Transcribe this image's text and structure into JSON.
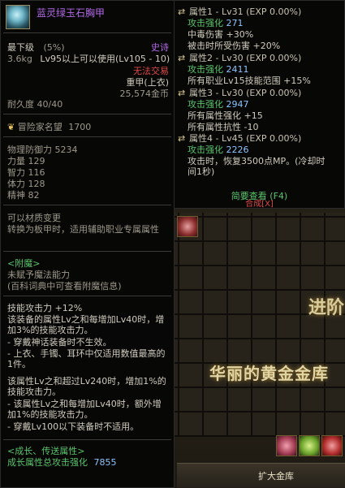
{
  "item": {
    "name": "蓝灵绿玉石胸甲",
    "grade": "最下级",
    "grade_pct": "(5%)",
    "rarity": "史诗",
    "weight": "3.6kg",
    "level_req": "Lv95以上可以使用(Lv105 - 10)",
    "trade": "无法交易",
    "slot": "重甲(上衣)",
    "price": "25,574金币",
    "durability": "耐久度 40/40",
    "fame_label": "冒险家名望",
    "fame_value": "1700",
    "stats": [
      {
        "label": "物理防御力",
        "value": "5234"
      },
      {
        "label": "力量",
        "value": "129"
      },
      {
        "label": "智力",
        "value": "116"
      },
      {
        "label": "体力",
        "value": "128"
      },
      {
        "label": "精神",
        "value": "82"
      }
    ],
    "material_change": "可以材质变更",
    "material_note": "转换为板甲时，适用辅助职业专属属性",
    "enchant_header": "<附魔>",
    "enchant_none": "未赋予魔法能力",
    "enchant_hint": "(百科词典中可查看附魔信息)",
    "skill_attack": "技能攻击力 +12%",
    "desc1": "该装备的属性Lv之和每增加Lv40时，增加3%的技能攻击力。",
    "desc2": "- 穿戴神话装备时不生效。",
    "desc3": "- 上衣、手镯、耳环中仅适用数值最高的1件。",
    "desc4": "该属性Lv之和超过Lv240时，增加1%的技能攻击力。",
    "desc5": "- 该属性Lv之和每增加Lv40时，额外增加1%的技能攻击力。",
    "desc6": "- 穿戴Lv100以下装备时不适用。",
    "growth_header": "<成长、传送属性>",
    "growth_total_label": "成长属性总攻击强化",
    "growth_total_value": "7855"
  },
  "attributes": [
    {
      "head": "属性1 - Lv31 (EXP 0.00%)",
      "lines": [
        {
          "label": "攻击强化",
          "value": "271"
        },
        {
          "label": "中毒伤害 +30%",
          "value": ""
        },
        {
          "label": "被击时所受伤害 +20%",
          "value": ""
        }
      ]
    },
    {
      "head": "属性2 - Lv30 (EXP 0.00%)",
      "lines": [
        {
          "label": "攻击强化",
          "value": "2411"
        },
        {
          "label": "所有职业Lv15技能范围 +15%",
          "value": ""
        }
      ]
    },
    {
      "head": "属性3 - Lv30 (EXP 0.00%)",
      "lines": [
        {
          "label": "攻击强化",
          "value": "2947"
        },
        {
          "label": "所有属性强化 +15",
          "value": ""
        },
        {
          "label": "所有属性抗性 -10",
          "value": ""
        }
      ]
    },
    {
      "head": "属性4 - Lv45 (EXP 0.00%)",
      "lines": [
        {
          "label": "攻击强化",
          "value": "2226"
        },
        {
          "label": "攻击时，恢复3500点MP。(冷却时间1秒)",
          "value": ""
        }
      ]
    }
  ],
  "footer": {
    "brief_view": "简要查看 (F4)",
    "compose": "合成[X]"
  },
  "background": {
    "promo_main": "华丽的黄金金库",
    "promo_side": "进阶",
    "expand_label": "扩大金库"
  },
  "icons": {
    "item": "armor-icon",
    "fame": "fame-badge-icon",
    "attr": "shuffle-icon"
  }
}
